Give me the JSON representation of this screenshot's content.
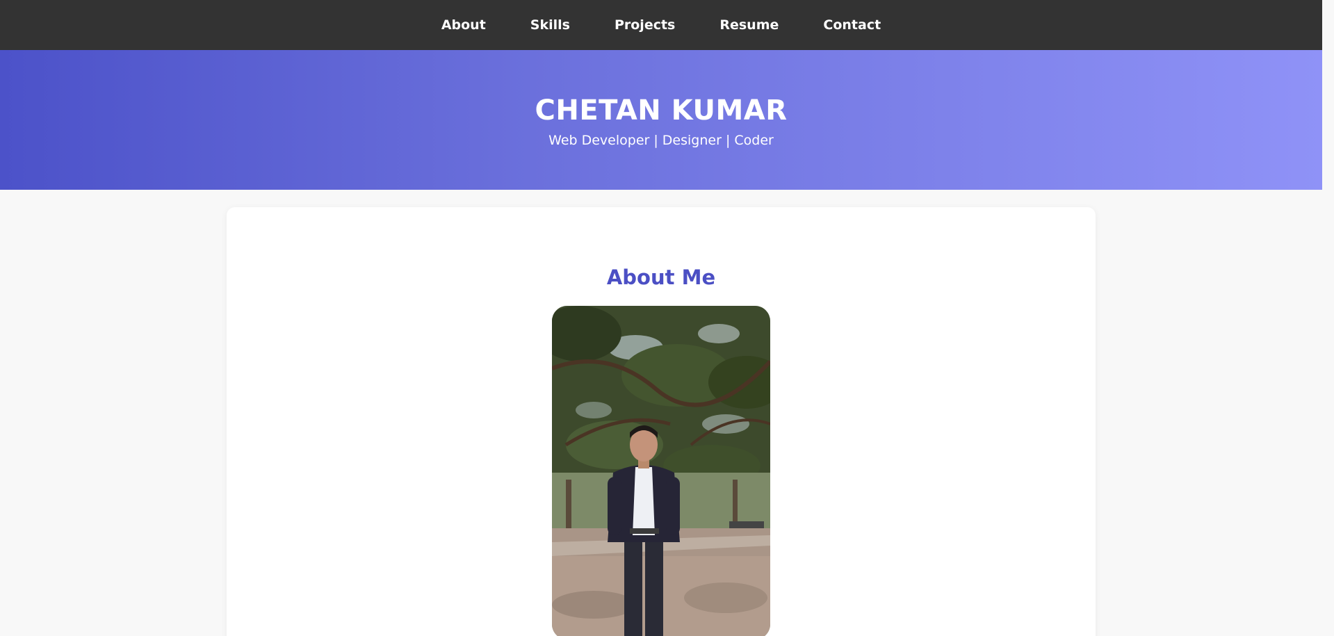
{
  "nav": {
    "items": [
      {
        "label": "About"
      },
      {
        "label": "Skills"
      },
      {
        "label": "Projects"
      },
      {
        "label": "Resume"
      },
      {
        "label": "Contact"
      }
    ]
  },
  "hero": {
    "title": "CHETAN KUMAR",
    "subtitle": "Web Developer | Designer | Coder"
  },
  "about": {
    "title": "About Me"
  },
  "colors": {
    "navbar": "#333333",
    "hero_start": "#4c52c9",
    "hero_end": "#8f92f7",
    "accent": "#4b4fc4",
    "page_bg": "#f8f8f8"
  },
  "icons": {
    "scroll_up": "scroll-up-arrow-icon",
    "scroll_down": "scroll-down-arrow-icon"
  }
}
